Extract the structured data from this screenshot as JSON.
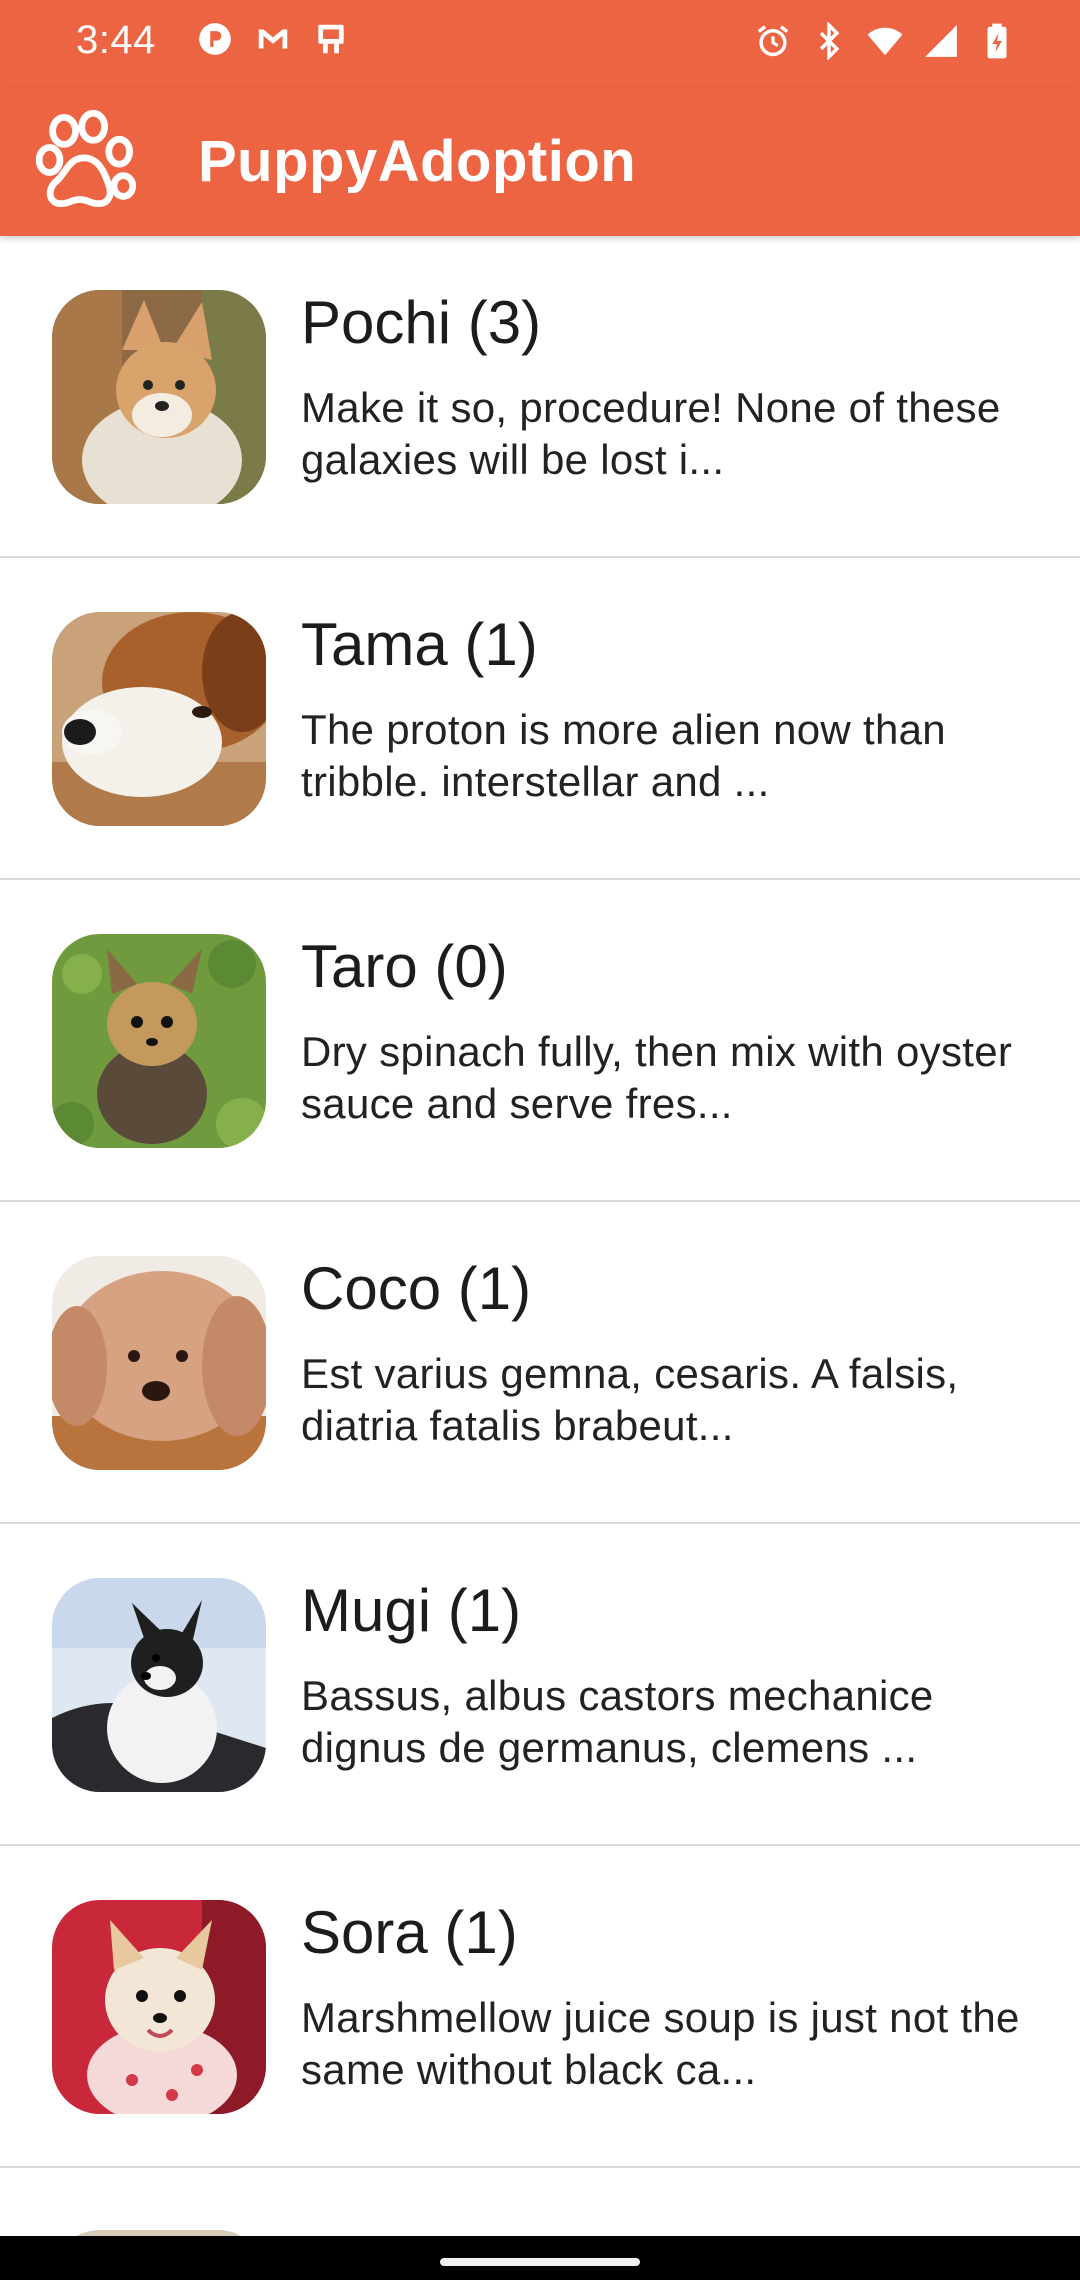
{
  "status_bar": {
    "time": "3:44",
    "left_icons": [
      "notification-icon",
      "gmail-icon",
      "sim-icon"
    ],
    "right_icons": [
      "alarm-icon",
      "bluetooth-icon",
      "wifi-icon",
      "signal-icon",
      "battery-icon"
    ]
  },
  "app_bar": {
    "title": "PuppyAdoption",
    "logo_icon": "paw-icon",
    "color": "#ED6442"
  },
  "puppies": [
    {
      "name": "Pochi (3)",
      "description": "Make it so, procedure! None of these galaxies will be lost i..."
    },
    {
      "name": "Tama (1)",
      "description": "The proton is more alien now than tribble. interstellar and ..."
    },
    {
      "name": "Taro (0)",
      "description": "Dry spinach fully, then mix with oyster sauce and serve fres..."
    },
    {
      "name": "Coco (1)",
      "description": "Est varius gemna, cesaris. A falsis, diatria fatalis brabeut..."
    },
    {
      "name": "Mugi (1)",
      "description": "Bassus, albus castors mechanice dignus de germanus, clemens ..."
    },
    {
      "name": "Sora (1)",
      "description": "Marshmellow juice soup is just not the same without black ca..."
    }
  ]
}
